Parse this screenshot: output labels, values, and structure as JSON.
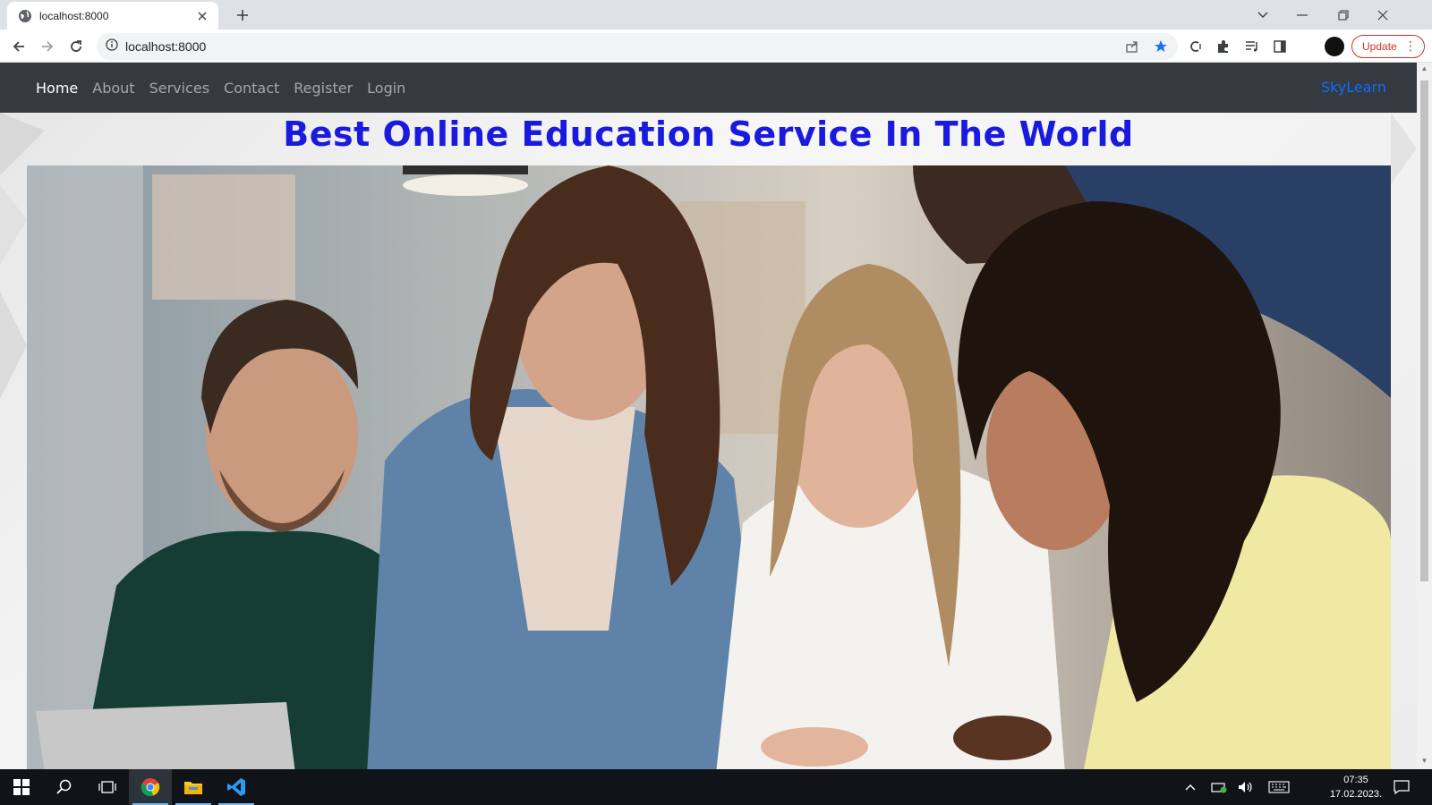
{
  "browser": {
    "tab_title": "localhost:8000",
    "url": "localhost:8000",
    "update_label": "Update"
  },
  "site": {
    "nav": [
      "Home",
      "About",
      "Services",
      "Contact",
      "Register",
      "Login"
    ],
    "brand": "SkyLearn",
    "headline": "Best Online Education Service In The World"
  },
  "taskbar": {
    "time": "07:35",
    "date": "17.02.2023."
  },
  "colors": {
    "navbar": "#343a40",
    "brand": "#0d6efd",
    "headline": "#1a1adf",
    "update": "#d93025"
  }
}
